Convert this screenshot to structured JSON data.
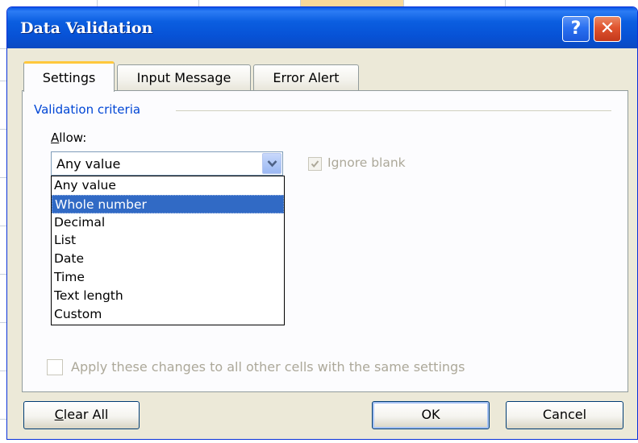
{
  "dialog": {
    "title": "Data Validation",
    "help_glyph": "?",
    "close_glyph": "✕"
  },
  "tabs": [
    {
      "label": "Settings",
      "active": true
    },
    {
      "label": "Input Message",
      "active": false
    },
    {
      "label": "Error Alert",
      "active": false
    }
  ],
  "settings": {
    "section_title": "Validation criteria",
    "allow_label_key": "A",
    "allow_label_rest": "llow:",
    "allow_value": "Any value",
    "allow_options": [
      "Any value",
      "Whole number",
      "Decimal",
      "List",
      "Date",
      "Time",
      "Text length",
      "Custom"
    ],
    "highlighted_option": "Whole number",
    "ignore_blank_label": "Ignore blank",
    "ignore_blank_checked": true,
    "apply_all_label": "Apply these changes to all other cells with the same settings",
    "apply_all_checked": false
  },
  "buttons": {
    "clear_all_key": "C",
    "clear_all_rest": "lear All",
    "ok": "OK",
    "cancel": "Cancel"
  },
  "colors": {
    "titlebar": "#0752d6",
    "selection": "#316ac5",
    "section_title": "#0046d5",
    "active_tab_accent": "#ffc83c",
    "disabled_text": "#aca899"
  },
  "icons": {
    "help": "question-mark-icon",
    "close": "close-x-icon",
    "dropdown": "chevron-down-icon",
    "check": "checkmark-icon"
  }
}
